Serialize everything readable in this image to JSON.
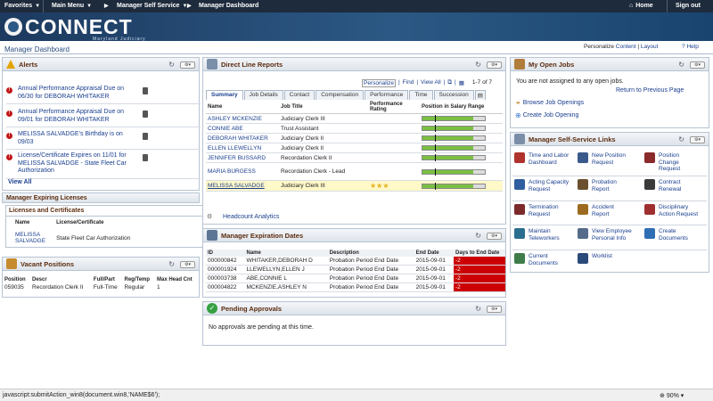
{
  "topnav": {
    "favorites": "Favorites",
    "main_menu": "Main Menu",
    "self_service": "Manager Self Service",
    "dashboard": "Manager Dashboard",
    "home": "Home",
    "signout": "Sign out"
  },
  "banner": {
    "logo": "CONNECT",
    "subtitle": "Maryland Judiciary"
  },
  "page": {
    "title": "Manager Dashboard",
    "personalize_prefix": "Personalize",
    "personalize_content": "Content",
    "personalize_sep": "|",
    "personalize_layout": "Layout",
    "help": "Help"
  },
  "alerts": {
    "title": "Alerts",
    "items": [
      {
        "text": "Annual Performance Appraisal Due on 06/30 for DEBORAH WHITAKER"
      },
      {
        "text": "Annual Performance Appraisal Due on 09/01 for DEBORAH WHITAKER"
      },
      {
        "text": "MELISSA SALVADGE's Birthday is on 09/03"
      },
      {
        "text": "License/Certificate Expires on 11/01 for MELISSA SALVADGE - State Fleet Car Authorization"
      }
    ],
    "view_all": "View All"
  },
  "licenses": {
    "title": "Manager Expiring Licenses",
    "subtitle": "Licenses and Certificates",
    "headers": [
      "Name",
      "License/Certificate"
    ],
    "rows": [
      [
        "MELISSA SALVADGE",
        "State Fleet Car Authorization"
      ]
    ]
  },
  "vacant": {
    "title": "Vacant Positions",
    "headers": [
      "Position",
      "Descr",
      "Full/Part",
      "Reg/Temp",
      "Max Head Cnt"
    ],
    "rows": [
      [
        "059035",
        "Recordation Clerk II",
        "Full-Time",
        "Regular",
        "1"
      ]
    ]
  },
  "direct": {
    "title": "Direct Line Reports",
    "personalize": "Personalize",
    "find": "Find",
    "view_all": "View All",
    "paging": "1-7 of 7",
    "tabs": [
      "Summary",
      "Job Details",
      "Contact",
      "Compensation",
      "Performance",
      "Time",
      "Succession"
    ],
    "headers": [
      "Name",
      "Job Title",
      "Performance Rating",
      "Position in Salary Range"
    ],
    "rows": [
      {
        "name": "ASHLEY MCKENZIE",
        "title": "Judiciary Clerk III",
        "rating": "",
        "fill": 0.82
      },
      {
        "name": "CONNIE ABE",
        "title": "Trust Assistant",
        "rating": "",
        "fill": 0.82
      },
      {
        "name": "DEBORAH WHITAKER",
        "title": "Judiciary Clerk II",
        "rating": "",
        "fill": 0.82
      },
      {
        "name": "ELLEN LLEWELLYN",
        "title": "Judiciary Clerk II",
        "rating": "",
        "fill": 0.82
      },
      {
        "name": "JENNIFER BUSSARD",
        "title": "Recordation Clerk II",
        "rating": "",
        "fill": 0.82
      },
      {
        "name": "MARIA BURGESS",
        "title": "Recordation Clerk - Lead",
        "rating": "",
        "fill": 0.82
      },
      {
        "name": "MELISSA SALVADGE",
        "title": "Judiciary Clerk III",
        "rating": "★★★",
        "fill": 0.82
      }
    ],
    "analytics": "Headcount Analytics"
  },
  "expiration": {
    "title": "Manager Expiration Dates",
    "headers": [
      "ID",
      "Name",
      "Description",
      "End Date",
      "Days to End Date"
    ],
    "rows": [
      [
        "000000842",
        "WHITAKER,DEBORAH D",
        "Probation Period End Date",
        "2015-09-01",
        "-2"
      ],
      [
        "000001924",
        "LLEWELLYN,ELLEN J",
        "Probation Period End Date",
        "2015-09-01",
        "-2"
      ],
      [
        "000003738",
        "ABE,CONNIE L",
        "Probation Period End Date",
        "2015-09-01",
        "-2"
      ],
      [
        "000004822",
        "MCKENZIE,ASHLEY N",
        "Probation Period End Date",
        "2015-09-01",
        "-2"
      ]
    ]
  },
  "approvals": {
    "title": "Pending Approvals",
    "message": "No approvals are pending at this time."
  },
  "openjobs": {
    "title": "My Open Jobs",
    "message": "You are not assigned to any open jobs.",
    "return": "Return to Previous Page",
    "browse": "Browse Job Openings",
    "create": "Create Job Opening"
  },
  "mss": {
    "title": "Manager Self-Service Links",
    "links": [
      "Time and Labor Dashboard",
      "New Position Request",
      "Position Change Request",
      "Acting Capacity Request",
      "Probation Report",
      "Contract Renewal",
      "Termination Request",
      "Accident Report",
      "Disciplinary Action Request",
      "Maintain Teleworkers",
      "View Employee Personal Info",
      "Create Documents",
      "Current Documents",
      "Worklist",
      ""
    ]
  },
  "status": {
    "url": "javascript:submitAction_win8(document.win8,'NAME$6');",
    "zoom": "90%"
  }
}
